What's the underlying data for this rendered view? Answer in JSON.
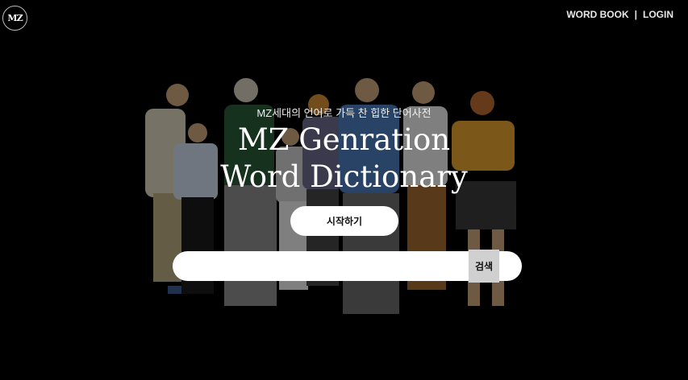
{
  "header": {
    "logo_text": "MZ",
    "nav": {
      "word_book": "WORD BOOK",
      "separator": "|",
      "login": "LOGIN"
    }
  },
  "hero": {
    "subtitle": "MZ세대의 언어로 가득 찬 힙한 단어사전",
    "title_line1": "MZ Genration",
    "title_line2": "Word Dictionary",
    "start_button": "시작하기"
  },
  "search": {
    "value": "",
    "placeholder": "",
    "button_label": "검색"
  },
  "icons": [
    "logo-icon"
  ],
  "colors": {
    "background": "#000000",
    "button_bg": "#ffffff",
    "search_button_bg": "#d0d0d0"
  }
}
